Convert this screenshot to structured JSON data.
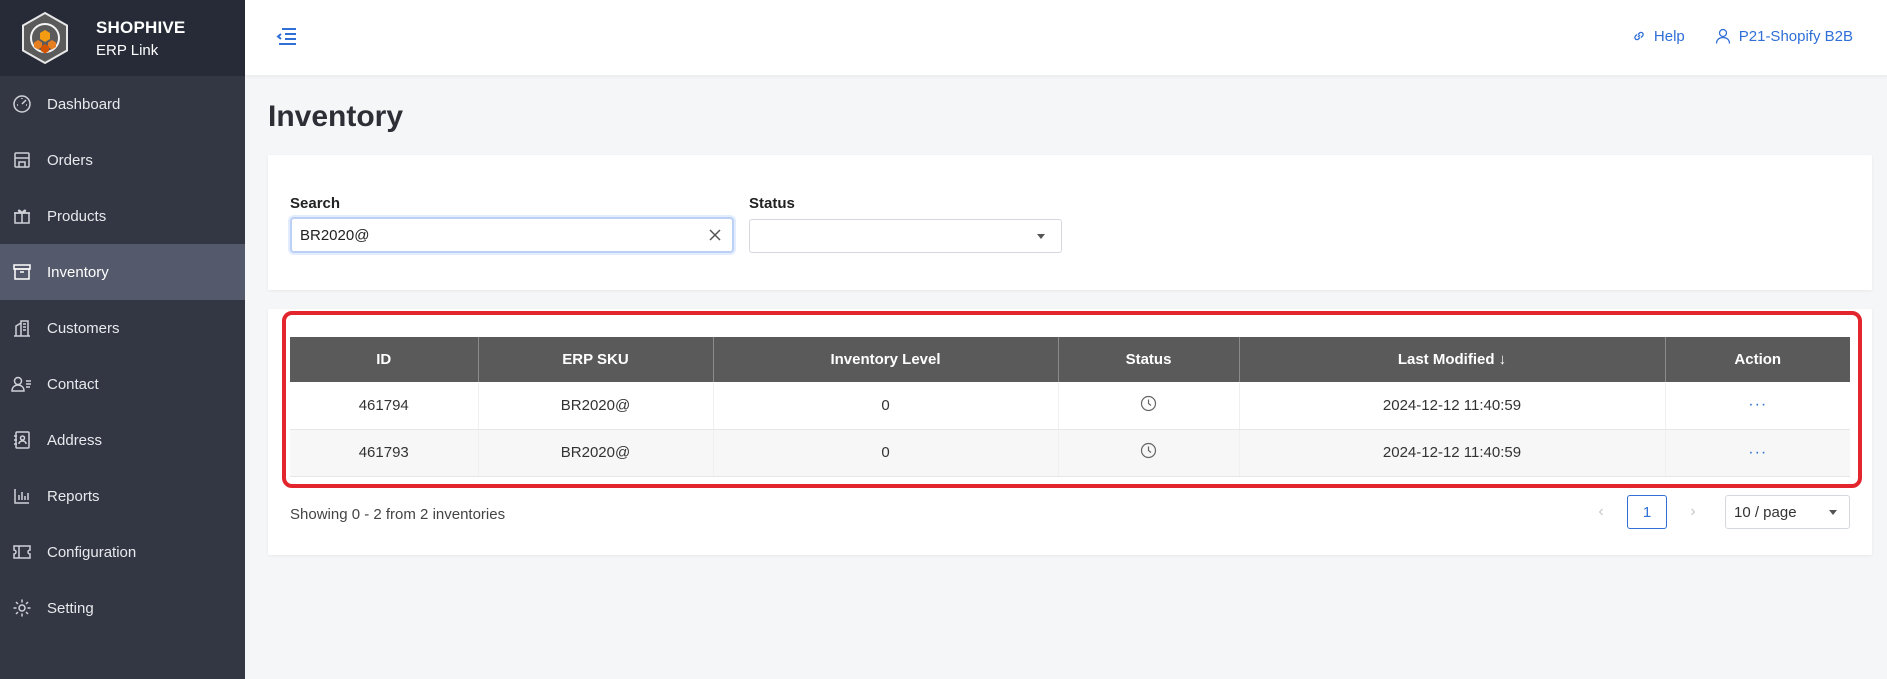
{
  "brand": {
    "name": "SHOPHIVE",
    "sub": "ERP Link"
  },
  "sidebar": {
    "items": [
      {
        "label": "Dashboard",
        "icon": "dashboard-icon"
      },
      {
        "label": "Orders",
        "icon": "store-icon"
      },
      {
        "label": "Products",
        "icon": "gift-icon"
      },
      {
        "label": "Inventory",
        "icon": "inventory-box-icon",
        "active": true
      },
      {
        "label": "Customers",
        "icon": "building-icon"
      },
      {
        "label": "Contact",
        "icon": "contact-icon"
      },
      {
        "label": "Address",
        "icon": "address-book-icon"
      },
      {
        "label": "Reports",
        "icon": "bar-chart-icon"
      },
      {
        "label": "Configuration",
        "icon": "ticket-icon"
      },
      {
        "label": "Setting",
        "icon": "gear-icon"
      }
    ]
  },
  "header": {
    "help": "Help",
    "account": "P21-Shopify B2B"
  },
  "page": {
    "title": "Inventory"
  },
  "filters": {
    "search_label": "Search",
    "search_value": "BR2020@",
    "status_label": "Status",
    "status_value": ""
  },
  "table": {
    "columns": [
      "ID",
      "ERP SKU",
      "Inventory Level",
      "Status",
      "Last Modified",
      "Action"
    ],
    "sort_indicator": "↓",
    "rows": [
      {
        "id": "461794",
        "sku": "BR2020@",
        "level": "0",
        "status_icon": "clock-icon",
        "modified": "2024-12-12 11:40:59",
        "action": "···"
      },
      {
        "id": "461793",
        "sku": "BR2020@",
        "level": "0",
        "status_icon": "clock-icon",
        "modified": "2024-12-12 11:40:59",
        "action": "···"
      }
    ]
  },
  "footer": {
    "showing": "Showing 0 - 2 from 2 inventories",
    "current_page": "1",
    "page_size": "10 / page"
  },
  "colors": {
    "sidebar": "#333744",
    "active": "#545a6b",
    "accent": "#2f6fd6",
    "highlight": "#e3262d",
    "table_header": "#5a5a5a"
  }
}
